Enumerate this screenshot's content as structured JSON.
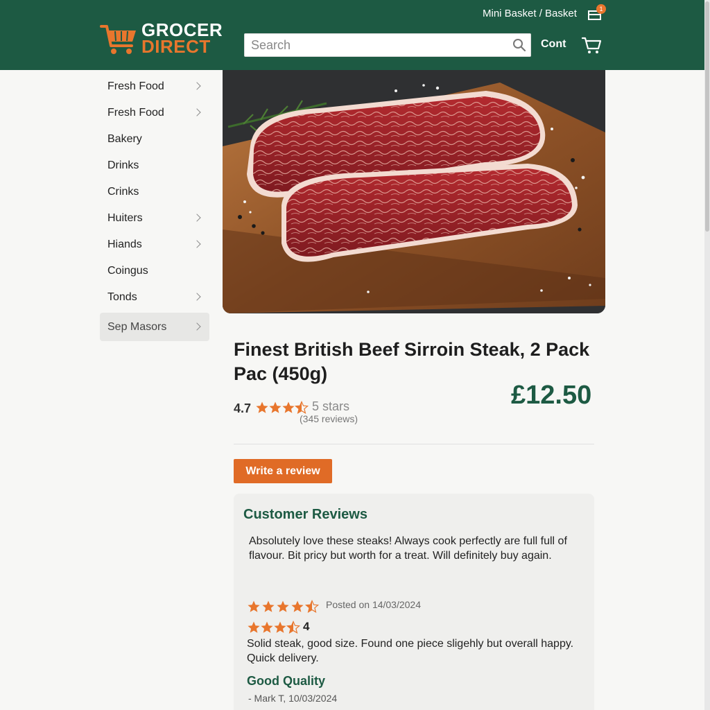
{
  "header": {
    "logo_line1": "GROCER",
    "logo_line2": "DIRECT",
    "mini_basket": "Mini Basket / Basket",
    "mini_badge": "1",
    "search_placeholder": "Search",
    "cont": "Cont"
  },
  "sidebar": {
    "items": [
      {
        "label": "Fresh Food",
        "chevron": true
      },
      {
        "label": "Fresh Food",
        "chevron": true
      },
      {
        "label": "Bakery",
        "chevron": false
      },
      {
        "label": "Drinks",
        "chevron": false
      },
      {
        "label": "Crinks",
        "chevron": false
      },
      {
        "label": "Huiters",
        "chevron": true
      },
      {
        "label": "Hiands",
        "chevron": true
      },
      {
        "label": "Coingus",
        "chevron": false
      },
      {
        "label": "Tonds",
        "chevron": true
      },
      {
        "label": "Sep Masors",
        "chevron": true,
        "active": true
      }
    ]
  },
  "product": {
    "title": "Finest British Beef Sirroin Steak, 2 Pack Pac (450g)",
    "rating": "4.7",
    "rating_stars": 4.5,
    "stars_label": "5 stars",
    "reviews_count": "(345 reviews)",
    "price": "£12.50",
    "write_review": "Write a review"
  },
  "reviews": {
    "heading": "Customer Reviews",
    "review1_text": "Absolutely love these steaks! Always cook perfectly are full full of flavour. Bit pricy but worth for a treat. Will definitely buy again.",
    "review2_stars": 4.5,
    "review2_date": "Posted on 14/03/2024",
    "review3_stars": 3.5,
    "review3_rating": "4",
    "review3_text": "Solid steak, good size. Found one piece sligehly but overall happy. Quick delivery.",
    "review3_title": "Good Quality",
    "review3_author": "- Mark T, 10/03/2024"
  },
  "colors": {
    "brand_green": "#1d5a43",
    "accent_orange": "#e06b26",
    "star_orange": "#e8762d"
  }
}
